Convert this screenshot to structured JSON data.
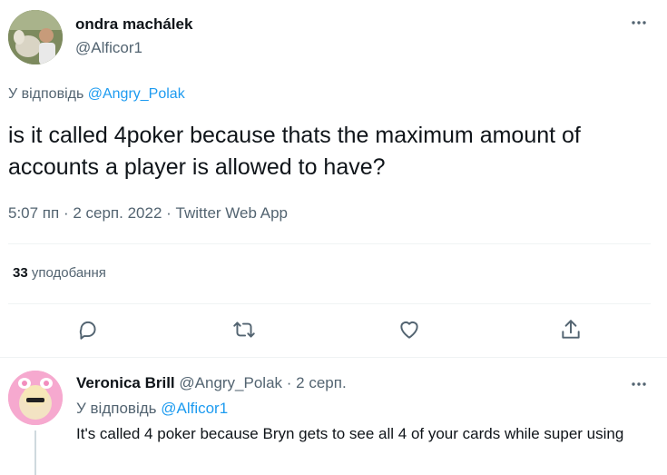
{
  "main_tweet": {
    "author_name": "ondra machálek",
    "author_handle": "@Alficor1",
    "reply_to_prefix": "У відповідь ",
    "reply_to_mention": "@Angry_Polak",
    "text": "is it called 4poker because thats the maximum amount of accounts a player is allowed to have?",
    "time": "5:07 пп",
    "date": "2 серп. 2022",
    "source": "Twitter Web App",
    "separator": " · ",
    "likes_count": "33",
    "likes_label": " уподобання"
  },
  "reply_tweet": {
    "author_name": "Veronica Brill",
    "author_handle": " @Angry_Polak",
    "date": " · 2 серп.",
    "reply_to_prefix": "У відповідь ",
    "reply_to_mention": "@Alficor1",
    "text": "It's called 4 poker because Bryn gets to see all 4 of your cards while super using"
  },
  "icons": {
    "reply": "reply-icon",
    "retweet": "retweet-icon",
    "like": "heart-icon",
    "share": "share-icon",
    "more": "more-icon"
  },
  "colors": {
    "accent": "#1d9bf0",
    "secondary_text": "#536471",
    "primary_text": "#0f1419",
    "divider": "#eff3f4"
  }
}
